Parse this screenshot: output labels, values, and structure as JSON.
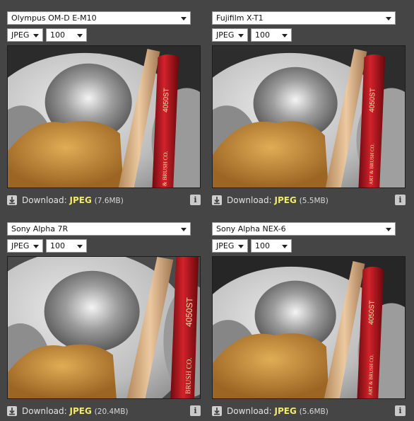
{
  "panels": [
    {
      "camera": "Olympus OM-D E-M10",
      "format": "JPEG",
      "quality": "100",
      "download_label": "Download:",
      "download_link": "JPEG",
      "download_size": "(7.6MB)",
      "pencil_text": "4050ST",
      "pencil_brand": "& BRUSH CO."
    },
    {
      "camera": "Fujifilm X-T1",
      "format": "JPEG",
      "quality": "100",
      "download_label": "Download:",
      "download_link": "JPEG",
      "download_size": "(5.5MB)",
      "pencil_text": "4050ST",
      "pencil_brand": "ART & BRUSH CO."
    },
    {
      "camera": "Sony Alpha 7R",
      "format": "JPEG",
      "quality": "100",
      "download_label": "Download:",
      "download_link": "JPEG",
      "download_size": "(20.4MB)",
      "pencil_text": "4050ST",
      "pencil_brand": "BRUSH CO."
    },
    {
      "camera": "Sony Alpha NEX-6",
      "format": "JPEG",
      "quality": "100",
      "download_label": "Download:",
      "download_link": "JPEG",
      "download_size": "(5.6MB)",
      "pencil_text": "4050ST",
      "pencil_brand": "ART & BRUSH CO."
    }
  ],
  "icons": {
    "download": "download-arrow-icon",
    "info": "info-icon"
  },
  "colors": {
    "background": "#454545",
    "download_link": "#f3e96b",
    "pencil": "#b3141d",
    "sponge": "#c8913a",
    "wood": "#e0b98c"
  }
}
